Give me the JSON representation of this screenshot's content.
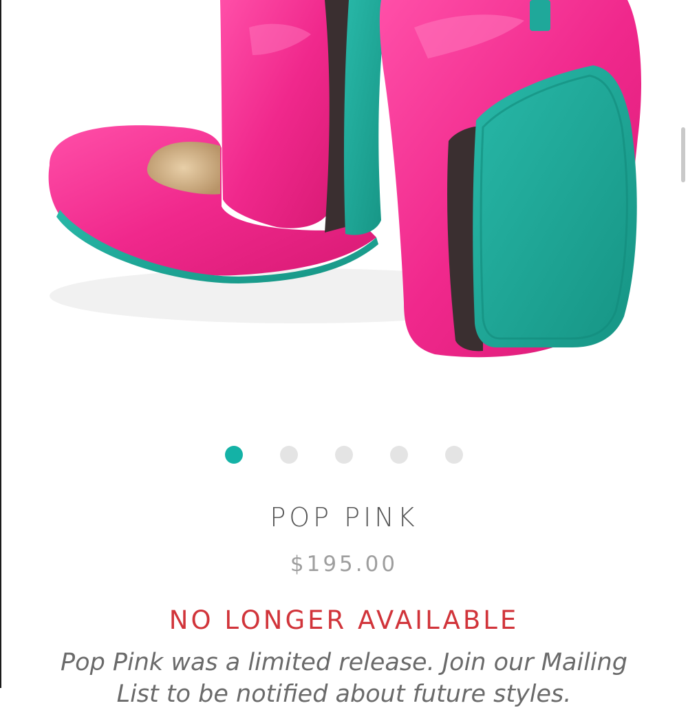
{
  "colors": {
    "accent": "#14b2a6",
    "alert": "#d1343a",
    "shoe_pink": "#f0288c",
    "sole_teal": "#1fa89a"
  },
  "carousel": {
    "dots": [
      {
        "active": true
      },
      {
        "active": false
      },
      {
        "active": false
      },
      {
        "active": false
      },
      {
        "active": false
      }
    ]
  },
  "product": {
    "name": "POP PINK",
    "price": "$195.00",
    "status": "NO LONGER AVAILABLE",
    "description": "Pop Pink was a limited release. Join our Mailing List to be notified about future styles."
  }
}
